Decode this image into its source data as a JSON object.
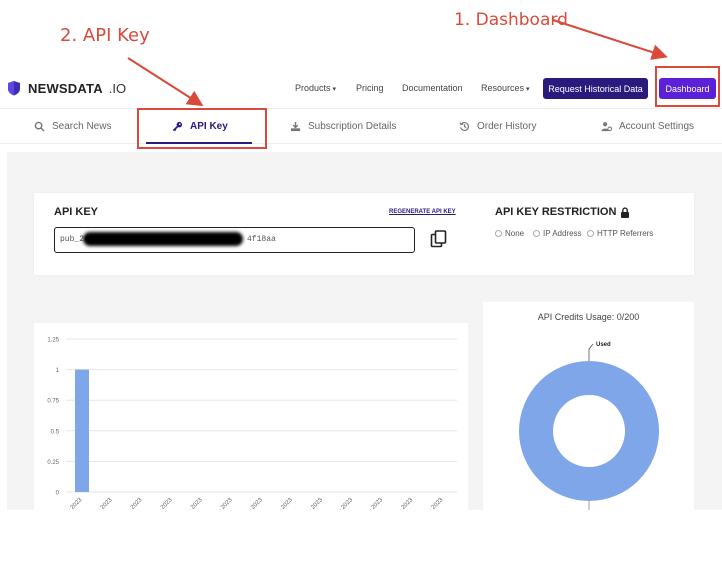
{
  "annotations": {
    "step1": "1. Dashboard",
    "step2": "2. API Key",
    "color": "#d94a3b"
  },
  "brand": {
    "name": "NEWSDATA",
    "suffix": ".IO",
    "color": "#3b2db5"
  },
  "nav": {
    "products": "Products",
    "pricing": "Pricing",
    "documentation": "Documentation",
    "resources": "Resources",
    "historical_button": "Request Historical Data",
    "dashboard_button": "Dashboard"
  },
  "tabs": [
    {
      "label": "Search News",
      "icon": "search-icon"
    },
    {
      "label": "API Key",
      "icon": "key-icon",
      "active": true
    },
    {
      "label": "Subscription Details",
      "icon": "subscription-icon"
    },
    {
      "label": "Order History",
      "icon": "history-icon"
    },
    {
      "label": "Account Settings",
      "icon": "user-settings-icon"
    }
  ],
  "api_key": {
    "title": "API KEY",
    "regenerate": "REGENERATE API KEY",
    "value_prefix": "pub_2435",
    "value_suffix": "4f18aa"
  },
  "restriction": {
    "title": "API KEY RESTRICTION",
    "options": [
      "None",
      "IP Address",
      "HTTP Referrers"
    ]
  },
  "chart_data": [
    {
      "type": "bar",
      "title": "",
      "categories": [
        "- 2023",
        "- 2023",
        "- 2023",
        "- 2023",
        "- 2023",
        "- 2023",
        "- 2023",
        "- 2023",
        "- 2023",
        "- 2023",
        "- 2023",
        "- 2023",
        "- 2023"
      ],
      "values": [
        1,
        0,
        0,
        0,
        0,
        0,
        0,
        0,
        0,
        0,
        0,
        0,
        0
      ],
      "ylim": [
        0,
        1.25
      ],
      "yticks": [
        "0",
        "0.25",
        "0.5",
        "0.75",
        "1",
        "1.25"
      ],
      "color": "#7fa6e8",
      "grid": true
    },
    {
      "type": "pie",
      "title": "API Credits Usage: 0/200",
      "labels": [
        "Used"
      ],
      "values": [
        1
      ],
      "color": "#7fa6e8"
    }
  ]
}
